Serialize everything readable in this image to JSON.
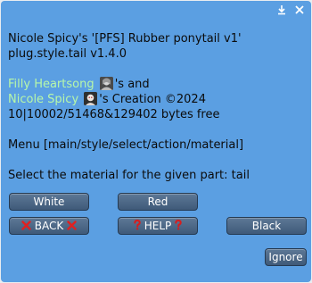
{
  "dialog": {
    "line1": "Nicole Spicy's '[PFS] Rubber ponytail v1'",
    "line2": "plug.style.tail v1.4.0",
    "creator1_name": "Filly Heartsong",
    "creator1_suffix": "'s and",
    "creator2_name": "Nicole Spicy",
    "creator2_suffix": "'s Creation ©2024",
    "memory": "10|10002/51468&129402 bytes free",
    "menu_path": "Menu [main/style/select/action/material]",
    "prompt": "Select the material for the given part: tail"
  },
  "buttons": {
    "white": "White",
    "red": "Red",
    "back": "BACK",
    "help": "HELP",
    "black": "Black",
    "ignore": "Ignore"
  },
  "title_bar": {
    "dock_icon": "dock-icon",
    "close_icon": "close-icon"
  },
  "colors": {
    "background": "#5b9fe2",
    "link": "#b7f7a9",
    "button": "#4a6684",
    "back_mark": "#e02020",
    "help_mark": "#d81c1c"
  }
}
